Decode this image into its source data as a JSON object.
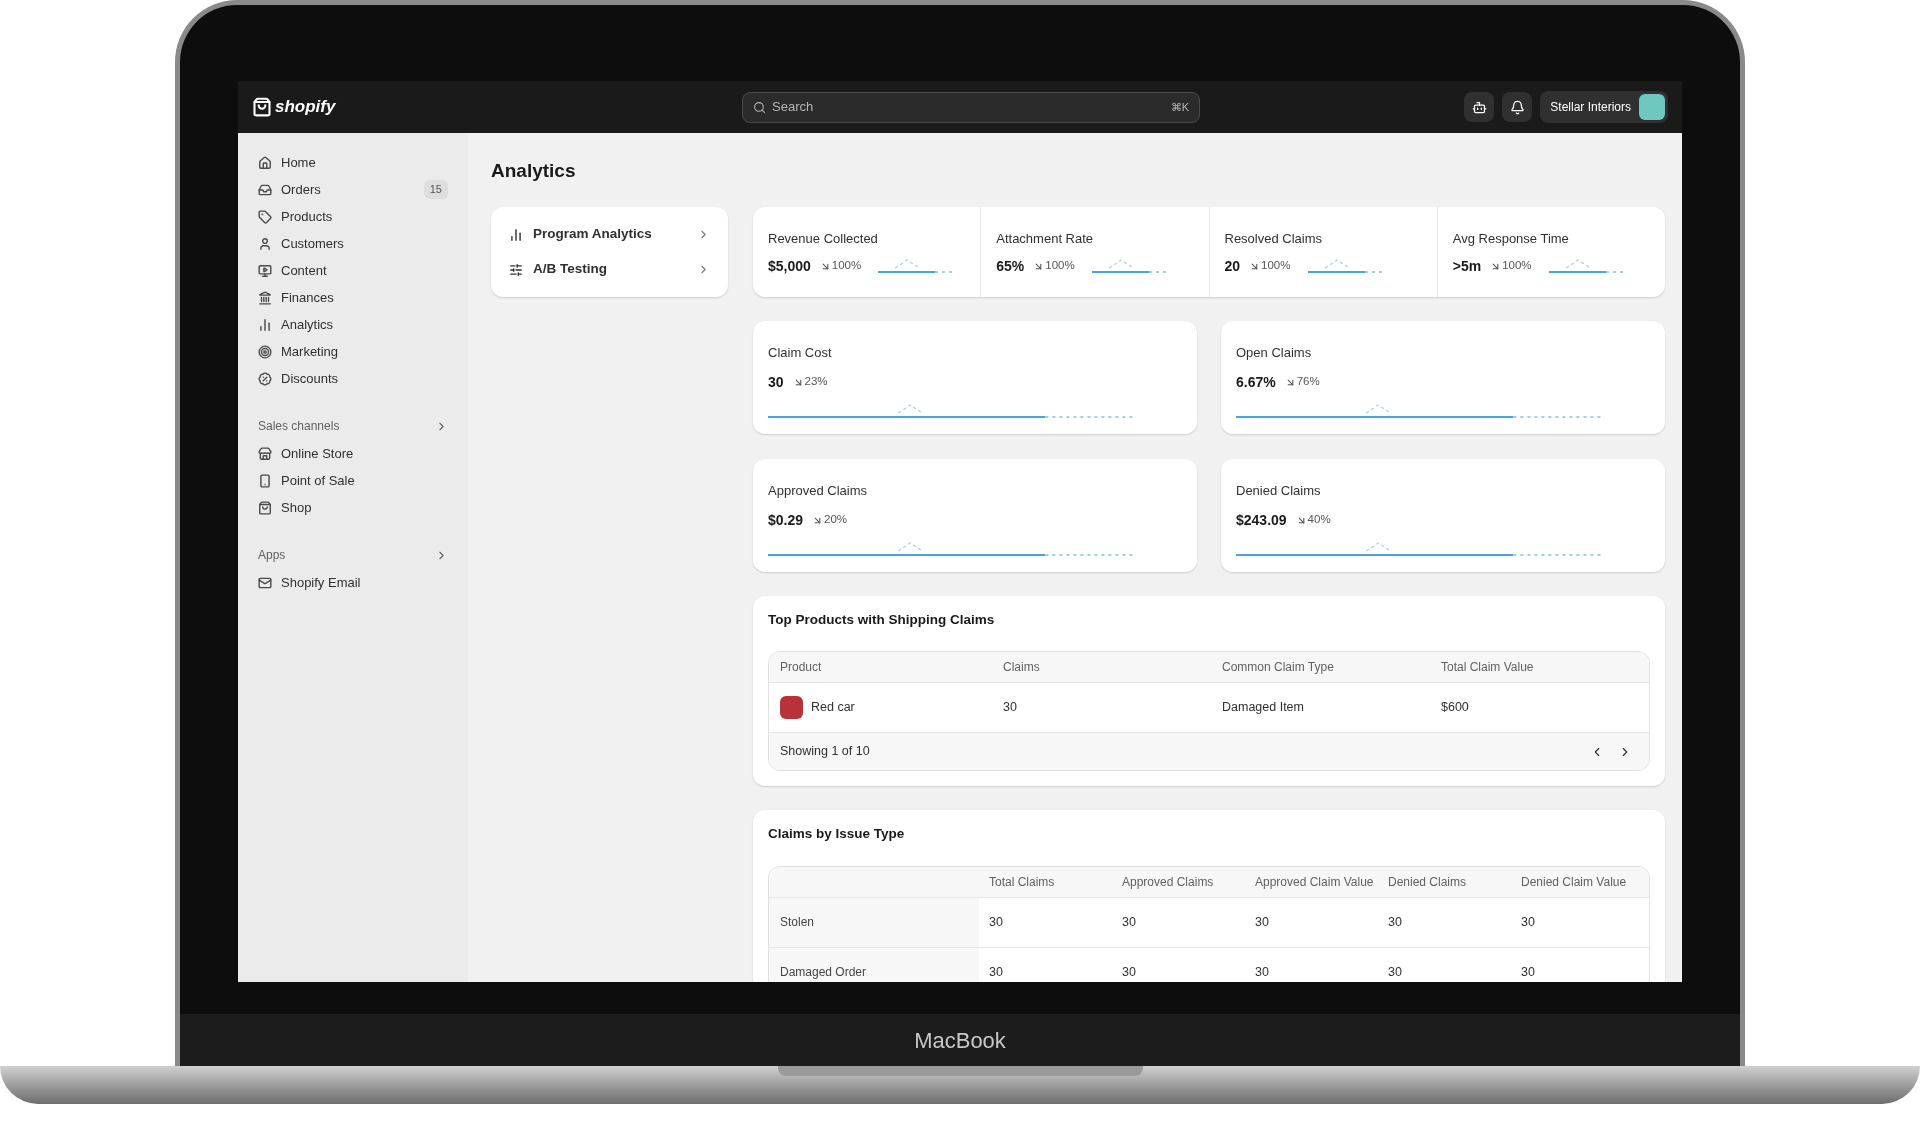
{
  "topbar": {
    "logo": "shopify",
    "search": {
      "placeholder": "Search",
      "shortcut": "⌘K"
    },
    "store": "Stellar Interiors"
  },
  "sidebar": {
    "items": [
      {
        "label": "Home",
        "selected": false
      },
      {
        "label": "Orders",
        "selected": false,
        "badge": "15"
      },
      {
        "label": "Products",
        "selected": false
      },
      {
        "label": "Customers",
        "selected": false
      },
      {
        "label": "Content",
        "selected": false
      },
      {
        "label": "Finances",
        "selected": false
      },
      {
        "label": "Analytics",
        "selected": false
      },
      {
        "label": "Marketing",
        "selected": false
      },
      {
        "label": "Discounts",
        "selected": false
      }
    ],
    "sections": [
      {
        "title": "Sales channels",
        "items": [
          {
            "label": "Online Store",
            "selected": false
          },
          {
            "label": "Point of Sale",
            "selected": false
          },
          {
            "label": "Shop",
            "selected": false
          }
        ]
      },
      {
        "title": "Apps",
        "items": [
          {
            "label": "Shopify Email",
            "selected": false
          }
        ]
      }
    ]
  },
  "page": {
    "title": "Analytics"
  },
  "nav": [
    {
      "label": "Program Analytics"
    },
    {
      "label": "A/B Testing"
    }
  ],
  "summary": [
    {
      "label": "Revenue Collected",
      "value": "$5,000",
      "change": "100%"
    },
    {
      "label": "Attachment Rate",
      "value": "65%",
      "change": "100%"
    },
    {
      "label": "Resolved Claims",
      "value": "20",
      "change": "100%"
    },
    {
      "label": "Avg Response Time",
      "value": ">5m",
      "change": "100%"
    }
  ],
  "metric_cards": [
    {
      "label": "Claim Cost",
      "value": "30",
      "change": "23%"
    },
    {
      "label": "Open Claims",
      "value": "6.67%",
      "change": "76%"
    },
    {
      "label": "Approved Claims",
      "value": "$0.29",
      "change": "20%"
    },
    {
      "label": "Denied Claims",
      "value": "$243.09",
      "change": "40%"
    }
  ],
  "top_products": {
    "title": "Top Products with Shipping Claims",
    "columns": [
      "Product",
      "Claims",
      "Common Claim Type",
      "Total Claim Value"
    ],
    "rows": [
      {
        "product": "Red car",
        "claims": "30",
        "type": "Damaged Item",
        "value": "$600"
      }
    ],
    "footer": "Showing 1 of 10"
  },
  "issue_types": {
    "title": "Claims by Issue Type",
    "columns": [
      "Total Claims",
      "Approved Claims",
      "Approved Claim Value",
      "Denied Claims",
      "Denied Claim Value"
    ],
    "rows": [
      {
        "label": "Stolen",
        "values": [
          "30",
          "30",
          "30",
          "30",
          "30"
        ]
      },
      {
        "label": "Damaged Order",
        "values": [
          "30",
          "30",
          "30",
          "30",
          "30"
        ]
      }
    ]
  },
  "device": {
    "label": "MacBook"
  }
}
